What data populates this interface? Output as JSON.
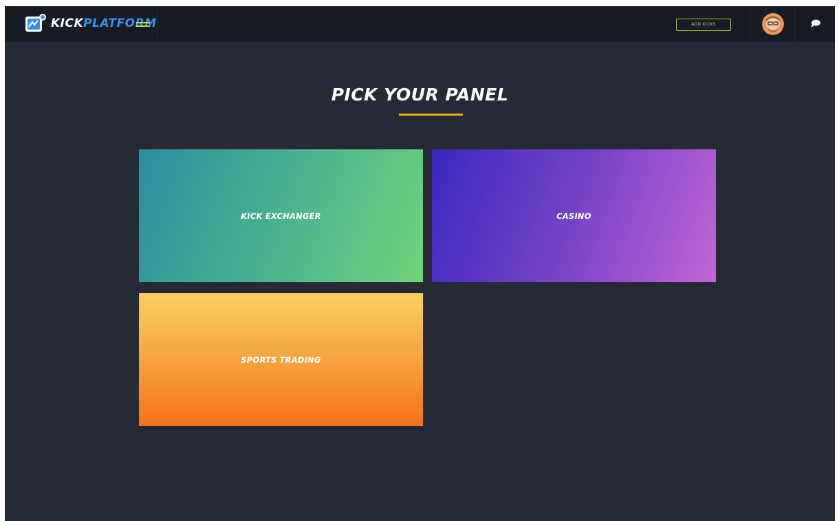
{
  "header": {
    "logo_part1": "KICK",
    "logo_part2": "PLATFORM",
    "add_button_label": "ADD KICKS",
    "icons": {
      "logo": "kick-platform-logo-icon",
      "menu": "hamburger-menu-icon",
      "avatar": "user-avatar",
      "chat": "chat-bubble-icon"
    }
  },
  "main": {
    "title": "PICK YOUR PANEL",
    "panels": [
      {
        "label": "KICK EXCHANGER"
      },
      {
        "label": "CASINO"
      },
      {
        "label": "SPORTS TRADING"
      }
    ]
  },
  "colors": {
    "background": "#252a35",
    "topbar": "#161b24",
    "accent": "#f2ad15",
    "brand_blue": "#3d8fe8",
    "menu_green": "#c6d33b"
  }
}
